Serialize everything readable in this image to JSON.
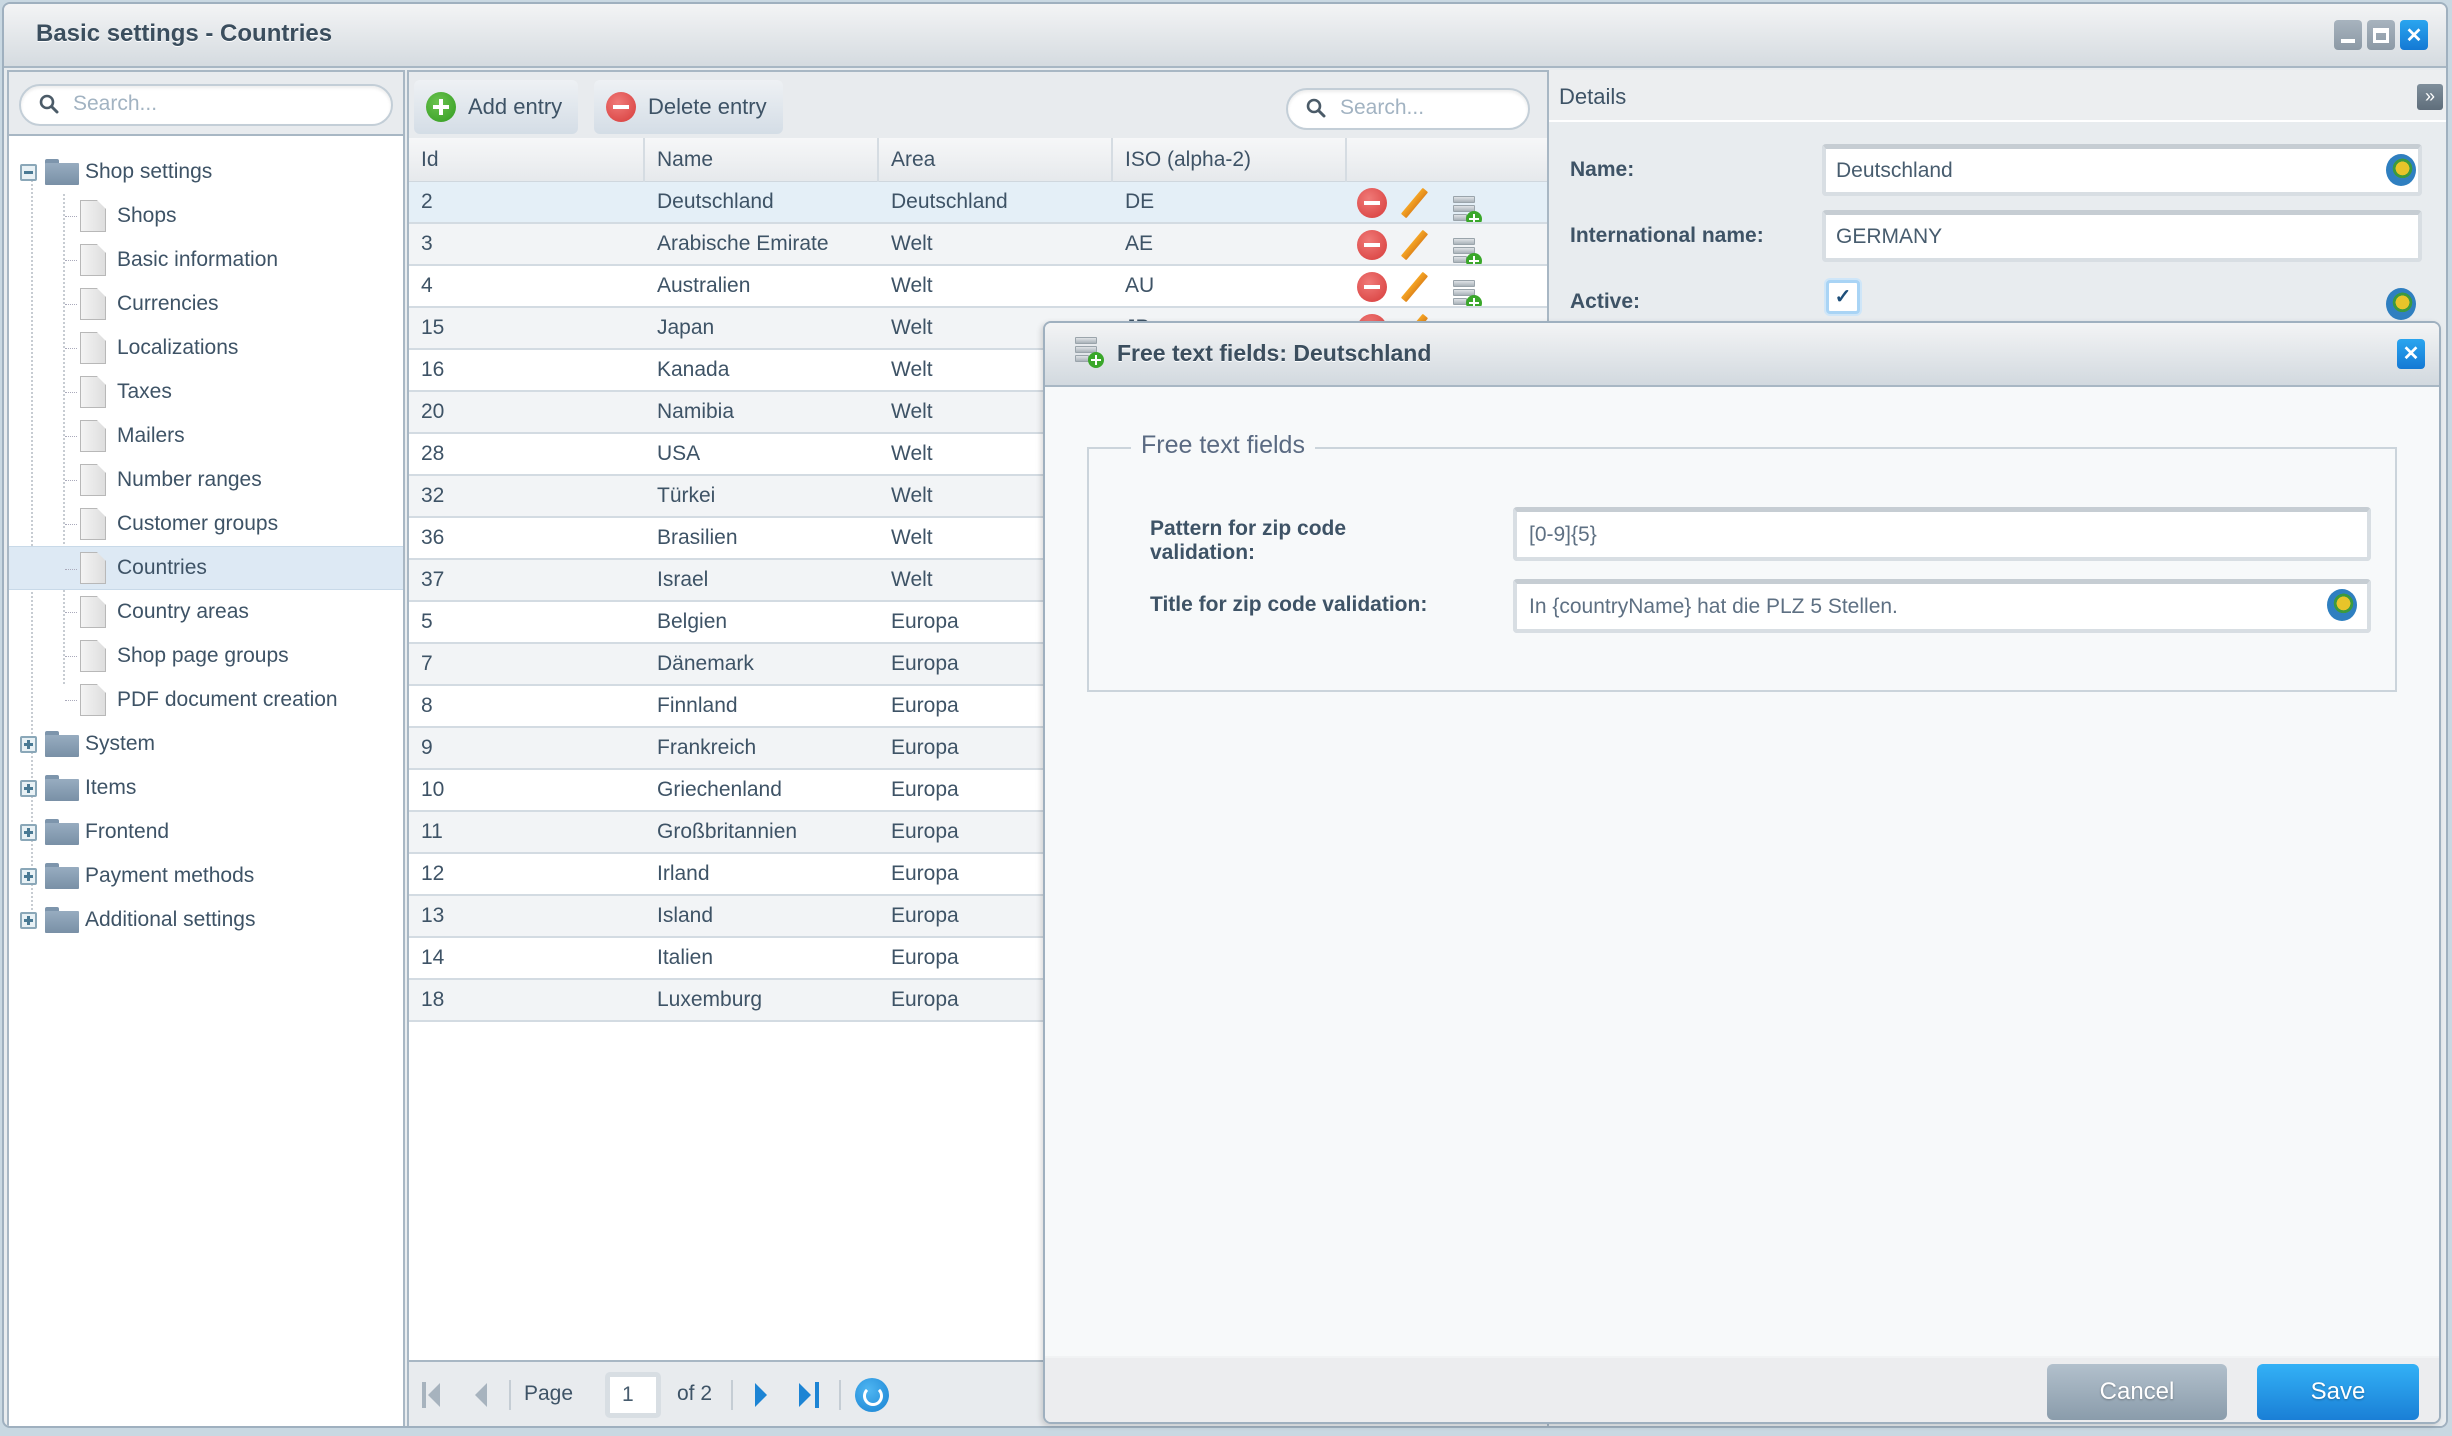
{
  "window": {
    "title": "Basic settings - Countries",
    "controls": [
      "minimize",
      "maximize",
      "close"
    ]
  },
  "tree": {
    "search_placeholder": "Search...",
    "items": [
      {
        "label": "Shop settings",
        "type": "folder",
        "expanded": true,
        "children": [
          {
            "label": "Shops"
          },
          {
            "label": "Basic information"
          },
          {
            "label": "Currencies"
          },
          {
            "label": "Localizations"
          },
          {
            "label": "Taxes"
          },
          {
            "label": "Mailers"
          },
          {
            "label": "Number ranges"
          },
          {
            "label": "Customer groups"
          },
          {
            "label": "Countries",
            "selected": true
          },
          {
            "label": "Country areas"
          },
          {
            "label": "Shop page groups"
          },
          {
            "label": "PDF document creation"
          }
        ]
      },
      {
        "label": "System",
        "type": "folder",
        "expanded": false
      },
      {
        "label": "Items",
        "type": "folder",
        "expanded": false
      },
      {
        "label": "Frontend",
        "type": "folder",
        "expanded": false
      },
      {
        "label": "Payment methods",
        "type": "folder",
        "expanded": false
      },
      {
        "label": "Additional settings",
        "type": "folder",
        "expanded": false
      }
    ]
  },
  "grid": {
    "toolbar": {
      "add_label": "Add entry",
      "delete_label": "Delete entry",
      "search_placeholder": "Search..."
    },
    "columns": [
      "Id",
      "Name",
      "Area",
      "ISO (alpha-2)",
      ""
    ],
    "rows": [
      {
        "id": "2",
        "name": "Deutschland",
        "area": "Deutschland",
        "iso": "DE",
        "selected": true
      },
      {
        "id": "3",
        "name": "Arabische Emirate",
        "area": "Welt",
        "iso": "AE"
      },
      {
        "id": "4",
        "name": "Australien",
        "area": "Welt",
        "iso": "AU"
      },
      {
        "id": "15",
        "name": "Japan",
        "area": "Welt",
        "iso": "JP"
      },
      {
        "id": "16",
        "name": "Kanada",
        "area": "Welt",
        "iso": ""
      },
      {
        "id": "20",
        "name": "Namibia",
        "area": "Welt",
        "iso": ""
      },
      {
        "id": "28",
        "name": "USA",
        "area": "Welt",
        "iso": ""
      },
      {
        "id": "32",
        "name": "Türkei",
        "area": "Welt",
        "iso": ""
      },
      {
        "id": "36",
        "name": "Brasilien",
        "area": "Welt",
        "iso": ""
      },
      {
        "id": "37",
        "name": "Israel",
        "area": "Welt",
        "iso": ""
      },
      {
        "id": "5",
        "name": "Belgien",
        "area": "Europa",
        "iso": ""
      },
      {
        "id": "7",
        "name": "Dänemark",
        "area": "Europa",
        "iso": ""
      },
      {
        "id": "8",
        "name": "Finnland",
        "area": "Europa",
        "iso": ""
      },
      {
        "id": "9",
        "name": "Frankreich",
        "area": "Europa",
        "iso": ""
      },
      {
        "id": "10",
        "name": "Griechenland",
        "area": "Europa",
        "iso": ""
      },
      {
        "id": "11",
        "name": "Großbritannien",
        "area": "Europa",
        "iso": ""
      },
      {
        "id": "12",
        "name": "Irland",
        "area": "Europa",
        "iso": ""
      },
      {
        "id": "13",
        "name": "Island",
        "area": "Europa",
        "iso": ""
      },
      {
        "id": "14",
        "name": "Italien",
        "area": "Europa",
        "iso": ""
      },
      {
        "id": "18",
        "name": "Luxemburg",
        "area": "Europa",
        "iso": ""
      }
    ],
    "row_actions": [
      "delete-icon",
      "edit-pencil-icon",
      "free-text-fields-icon"
    ],
    "pager": {
      "page_label": "Page",
      "current_page": "1",
      "of_label": "of 2"
    }
  },
  "details": {
    "title": "Details",
    "fields": {
      "name_label": "Name:",
      "name_value": "Deutschland",
      "intl_name_label": "International name:",
      "intl_name_value": "GERMANY",
      "active_label": "Active:",
      "active_checked": true
    }
  },
  "modal": {
    "title": "Free text fields: Deutschland",
    "fieldset_legend": "Free text fields",
    "fields": {
      "pattern_label": "Pattern for zip code validation:",
      "pattern_value": "[0-9]{5}",
      "title_label": "Title for zip code validation:",
      "title_value": "In {countryName} hat die PLZ 5 Stellen."
    },
    "cancel_label": "Cancel",
    "save_label": "Save"
  },
  "colors": {
    "accent": "#1a7fd6",
    "selected_row": "#e4eff7",
    "tree_selected": "#dde9f4",
    "text": "#3e5366"
  }
}
